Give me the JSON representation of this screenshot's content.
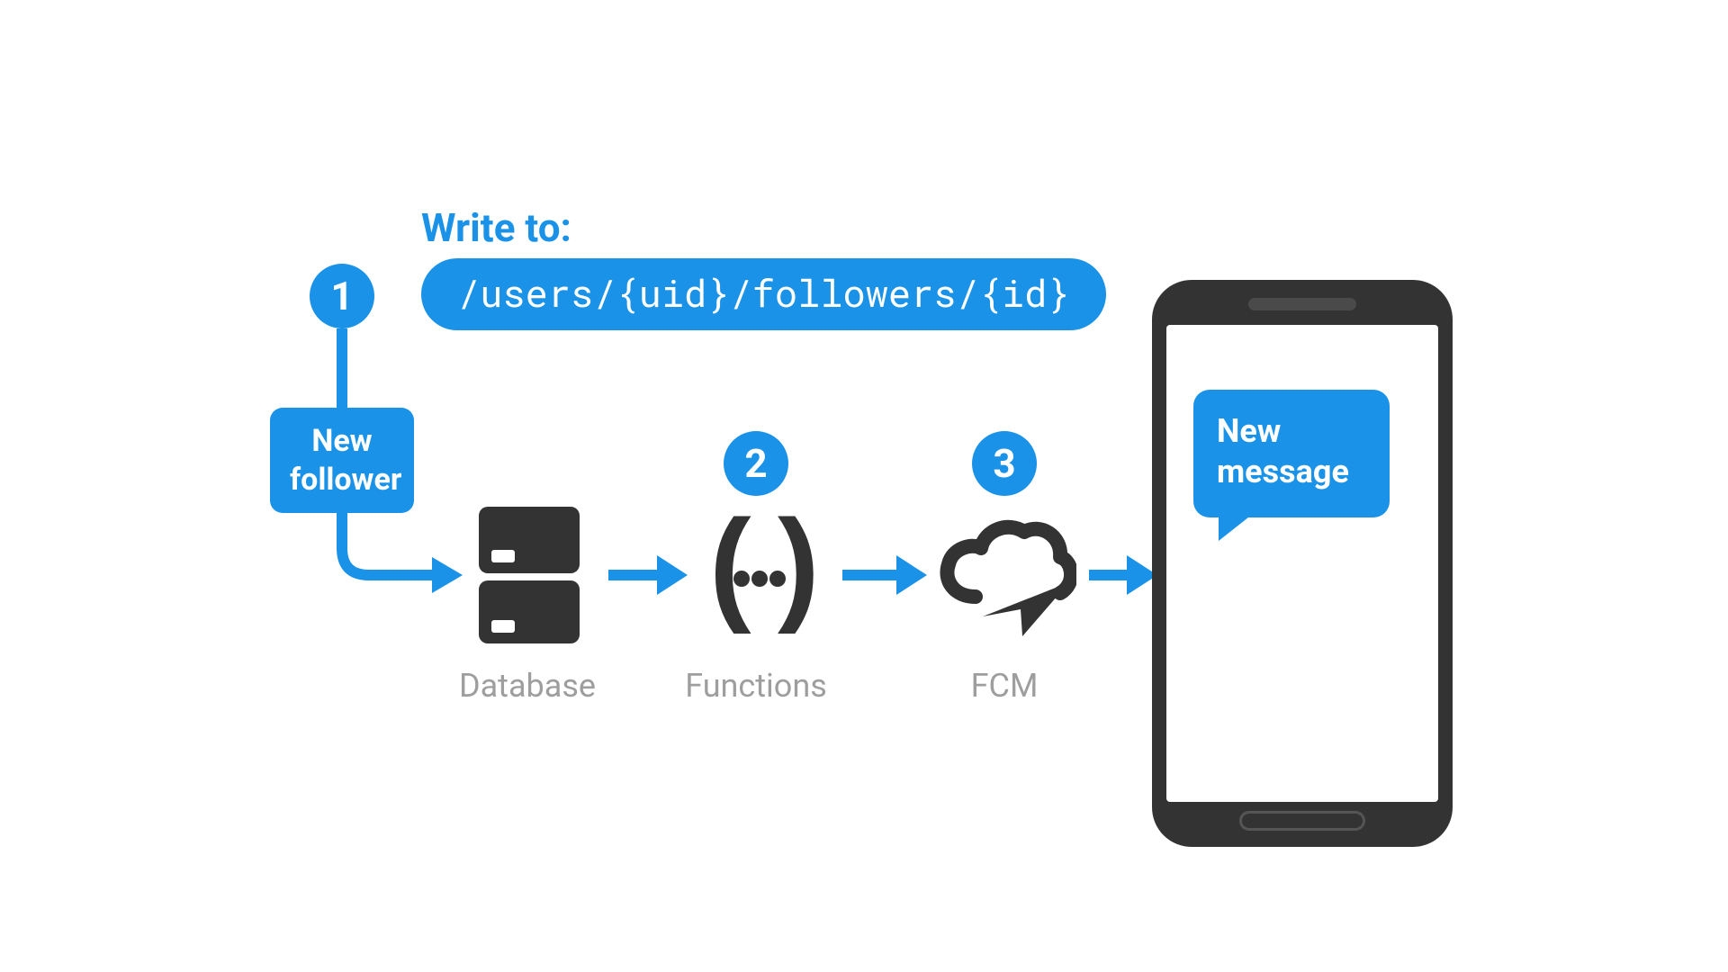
{
  "header": {
    "write_label": "Write to:",
    "path_code": "/users/{uid}/followers/{id}"
  },
  "badges": {
    "b1": "1",
    "b2": "2",
    "b3": "3"
  },
  "new_follower": {
    "line1": "New",
    "line2": "follower"
  },
  "nodes": {
    "database_label": "Database",
    "functions_label": "Functions",
    "fcm_label": "FCM"
  },
  "phone": {
    "msg_line1": "New",
    "msg_line2": "message"
  },
  "colors": {
    "accent": "#1a92e8",
    "icon_dark": "#333333",
    "label_gray": "#9e9e9e"
  }
}
